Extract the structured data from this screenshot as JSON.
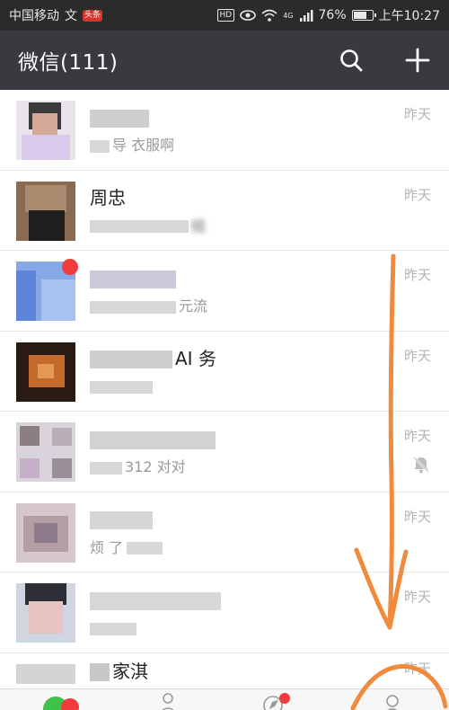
{
  "status_bar": {
    "carrier": "中国移动",
    "carrier_icon": "文",
    "app_badge": "头条",
    "hd": "HD",
    "network": "4G",
    "battery": "76%",
    "battery_level": 0.76,
    "time": "上午10:27"
  },
  "header": {
    "title": "微信(111)",
    "search_icon": "search-icon",
    "add_icon": "plus-icon"
  },
  "chats": [
    {
      "name": "",
      "preview": "导 衣服啊",
      "time": "昨天"
    },
    {
      "name": "周忠",
      "preview": "结",
      "time": "昨天"
    },
    {
      "name": "",
      "preview": "元流",
      "time": "昨天"
    },
    {
      "name": "AI 务",
      "preview": "",
      "time": "昨天"
    },
    {
      "name": "",
      "preview": "312 对对",
      "time": "昨天",
      "muted": true
    },
    {
      "name": "",
      "preview": "烦 了",
      "time": "昨天"
    },
    {
      "name": "",
      "preview": "",
      "time": "昨天"
    },
    {
      "name": "家淇",
      "preview": "",
      "time": "昨天"
    }
  ],
  "colors": {
    "header_bg": "#393a3f",
    "status_bg": "#2b2b2b",
    "annotation": "#f08a3c",
    "badge": "#f03c3c"
  }
}
